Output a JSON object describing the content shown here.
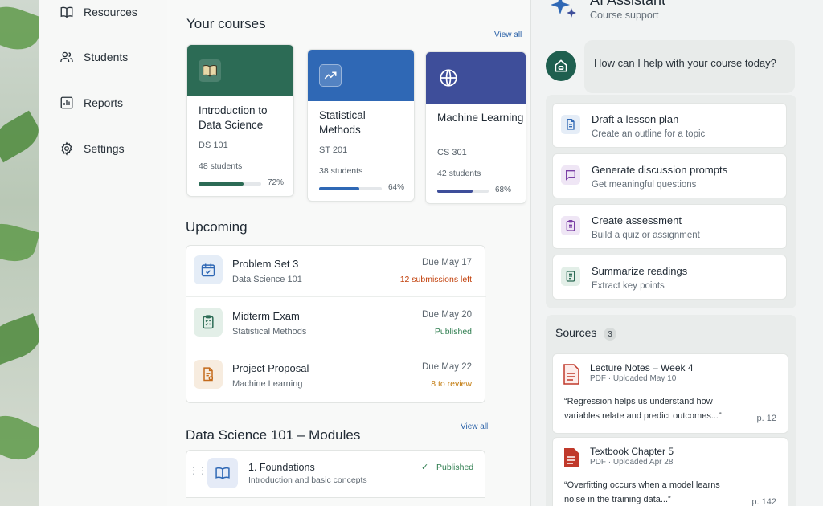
{
  "sidebar": {
    "items": [
      {
        "label": "Resources",
        "icon": "book-icon"
      },
      {
        "label": "Students",
        "icon": "users-icon"
      },
      {
        "label": "Reports",
        "icon": "bar-chart-icon"
      },
      {
        "label": "Settings",
        "icon": "gear-icon"
      }
    ]
  },
  "courses": {
    "title": "Your courses",
    "view_all": "View all",
    "items": [
      {
        "title": "Introduction to Data Science",
        "code": "DS 101",
        "students": "48 students",
        "progress": 0.72,
        "progress_label": "72%",
        "color": "#2c6b55",
        "icon": "open-book-icon"
      },
      {
        "title": "Statistical Methods",
        "code": "ST 201",
        "students": "38 students",
        "progress": 0.64,
        "progress_label": "64%",
        "color": "#2f68b5",
        "icon": "trend-chart-icon"
      },
      {
        "title": "Machine Learning",
        "code": "CS 301",
        "students": "42 students",
        "progress": 0.68,
        "progress_label": "68%",
        "color": "#3e4e9a",
        "icon": "globe-icon"
      }
    ]
  },
  "upcoming": {
    "title": "Upcoming",
    "items": [
      {
        "title": "Problem Set 3",
        "course": "Data Science 101",
        "due": "Due May 17",
        "status": "12 submissions left",
        "status_color": "#c2410c",
        "icon": "calendar-check-icon",
        "icon_color": "#2f68b5",
        "bg": "#e5edf7"
      },
      {
        "title": "Midterm Exam",
        "course": "Statistical Methods",
        "due": "Due May 20",
        "status": "Published",
        "status_color": "#2e7d4f",
        "icon": "clipboard-icon",
        "icon_color": "#2c6b55",
        "bg": "#e3efe8"
      },
      {
        "title": "Project Proposal",
        "course": "Machine Learning",
        "due": "Due May 22",
        "status": "8 to review",
        "status_color": "#c27a0c",
        "icon": "document-edit-icon",
        "icon_color": "#c46a1a",
        "bg": "#f7ecdf"
      }
    ]
  },
  "modules": {
    "title": "Data Science 101 – Modules",
    "view_all": "View all",
    "items": [
      {
        "title": "1. Foundations",
        "desc": "Introduction and basic concepts",
        "status": "Published"
      }
    ]
  },
  "assistant": {
    "title": "AI Assistant",
    "subtitle": "Course support",
    "greeting": "How can I help with your course today?",
    "actions": [
      {
        "title": "Draft a lesson plan",
        "desc": "Create an outline for a topic",
        "icon": "document-icon",
        "color": "#2f68b5",
        "bg": "#e5edf7"
      },
      {
        "title": "Generate discussion prompts",
        "desc": "Get meaningful questions",
        "icon": "chat-icon",
        "color": "#7a3fa5",
        "bg": "#efe6f5"
      },
      {
        "title": "Create assessment",
        "desc": "Build a quiz or assignment",
        "icon": "clipboard-list-icon",
        "color": "#7a3fa5",
        "bg": "#efe6f5"
      },
      {
        "title": "Summarize readings",
        "desc": "Extract key points",
        "icon": "notes-icon",
        "color": "#2c6b55",
        "bg": "#e3efe8"
      }
    ],
    "sources": {
      "title": "Sources",
      "count": "3",
      "items": [
        {
          "name": "Lecture Notes – Week 4",
          "meta": "PDF · Uploaded May 10",
          "quote": "“Regression helps us understand how variables relate and predict outcomes...”",
          "page": "p. 12",
          "icon": "pdf-icon"
        },
        {
          "name": "Textbook Chapter 5",
          "meta": "PDF · Uploaded Apr 28",
          "quote": "“Overfitting occurs when a model learns noise in the training data...”",
          "page": "p. 142",
          "icon": "pdf-icon"
        }
      ]
    }
  }
}
